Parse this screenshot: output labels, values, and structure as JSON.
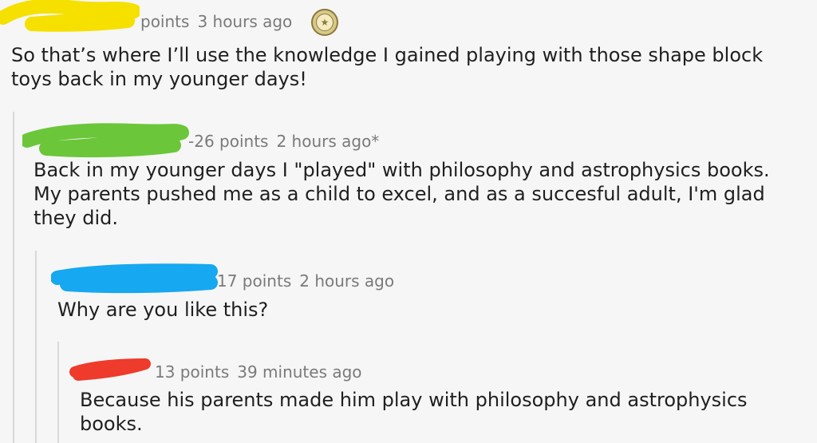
{
  "comments": [
    {
      "score": "points",
      "time": "3 hours ago",
      "text": "So that’s where I’ll use the knowledge I gained playing with those shape block toys back in my younger days!",
      "redaction_color": "#f5e000",
      "gilded": true,
      "gild_icon": "star-icon"
    },
    {
      "score": "-26 points",
      "time": "2 hours ago*",
      "text": "Back in my younger days I \"played\" with philosophy and astrophysics books. My parents pushed me as a child to excel, and as a succesful adult, I'm glad they did.",
      "redaction_color": "#6cc63a"
    },
    {
      "score": "17 points",
      "time": "2 hours ago",
      "text": "Why are you like this?",
      "redaction_color": "#16a8f0"
    },
    {
      "score": "13 points",
      "time": "39 minutes ago",
      "text": "Because his parents made him play with philosophy and astrophysics books.",
      "redaction_color": "#ee3b2c"
    }
  ],
  "colors": {
    "background": "#f6f6f6",
    "meta_text": "#7a7a7a",
    "body_text": "#1f1f1f",
    "thread_line": "#d8d8d8"
  }
}
